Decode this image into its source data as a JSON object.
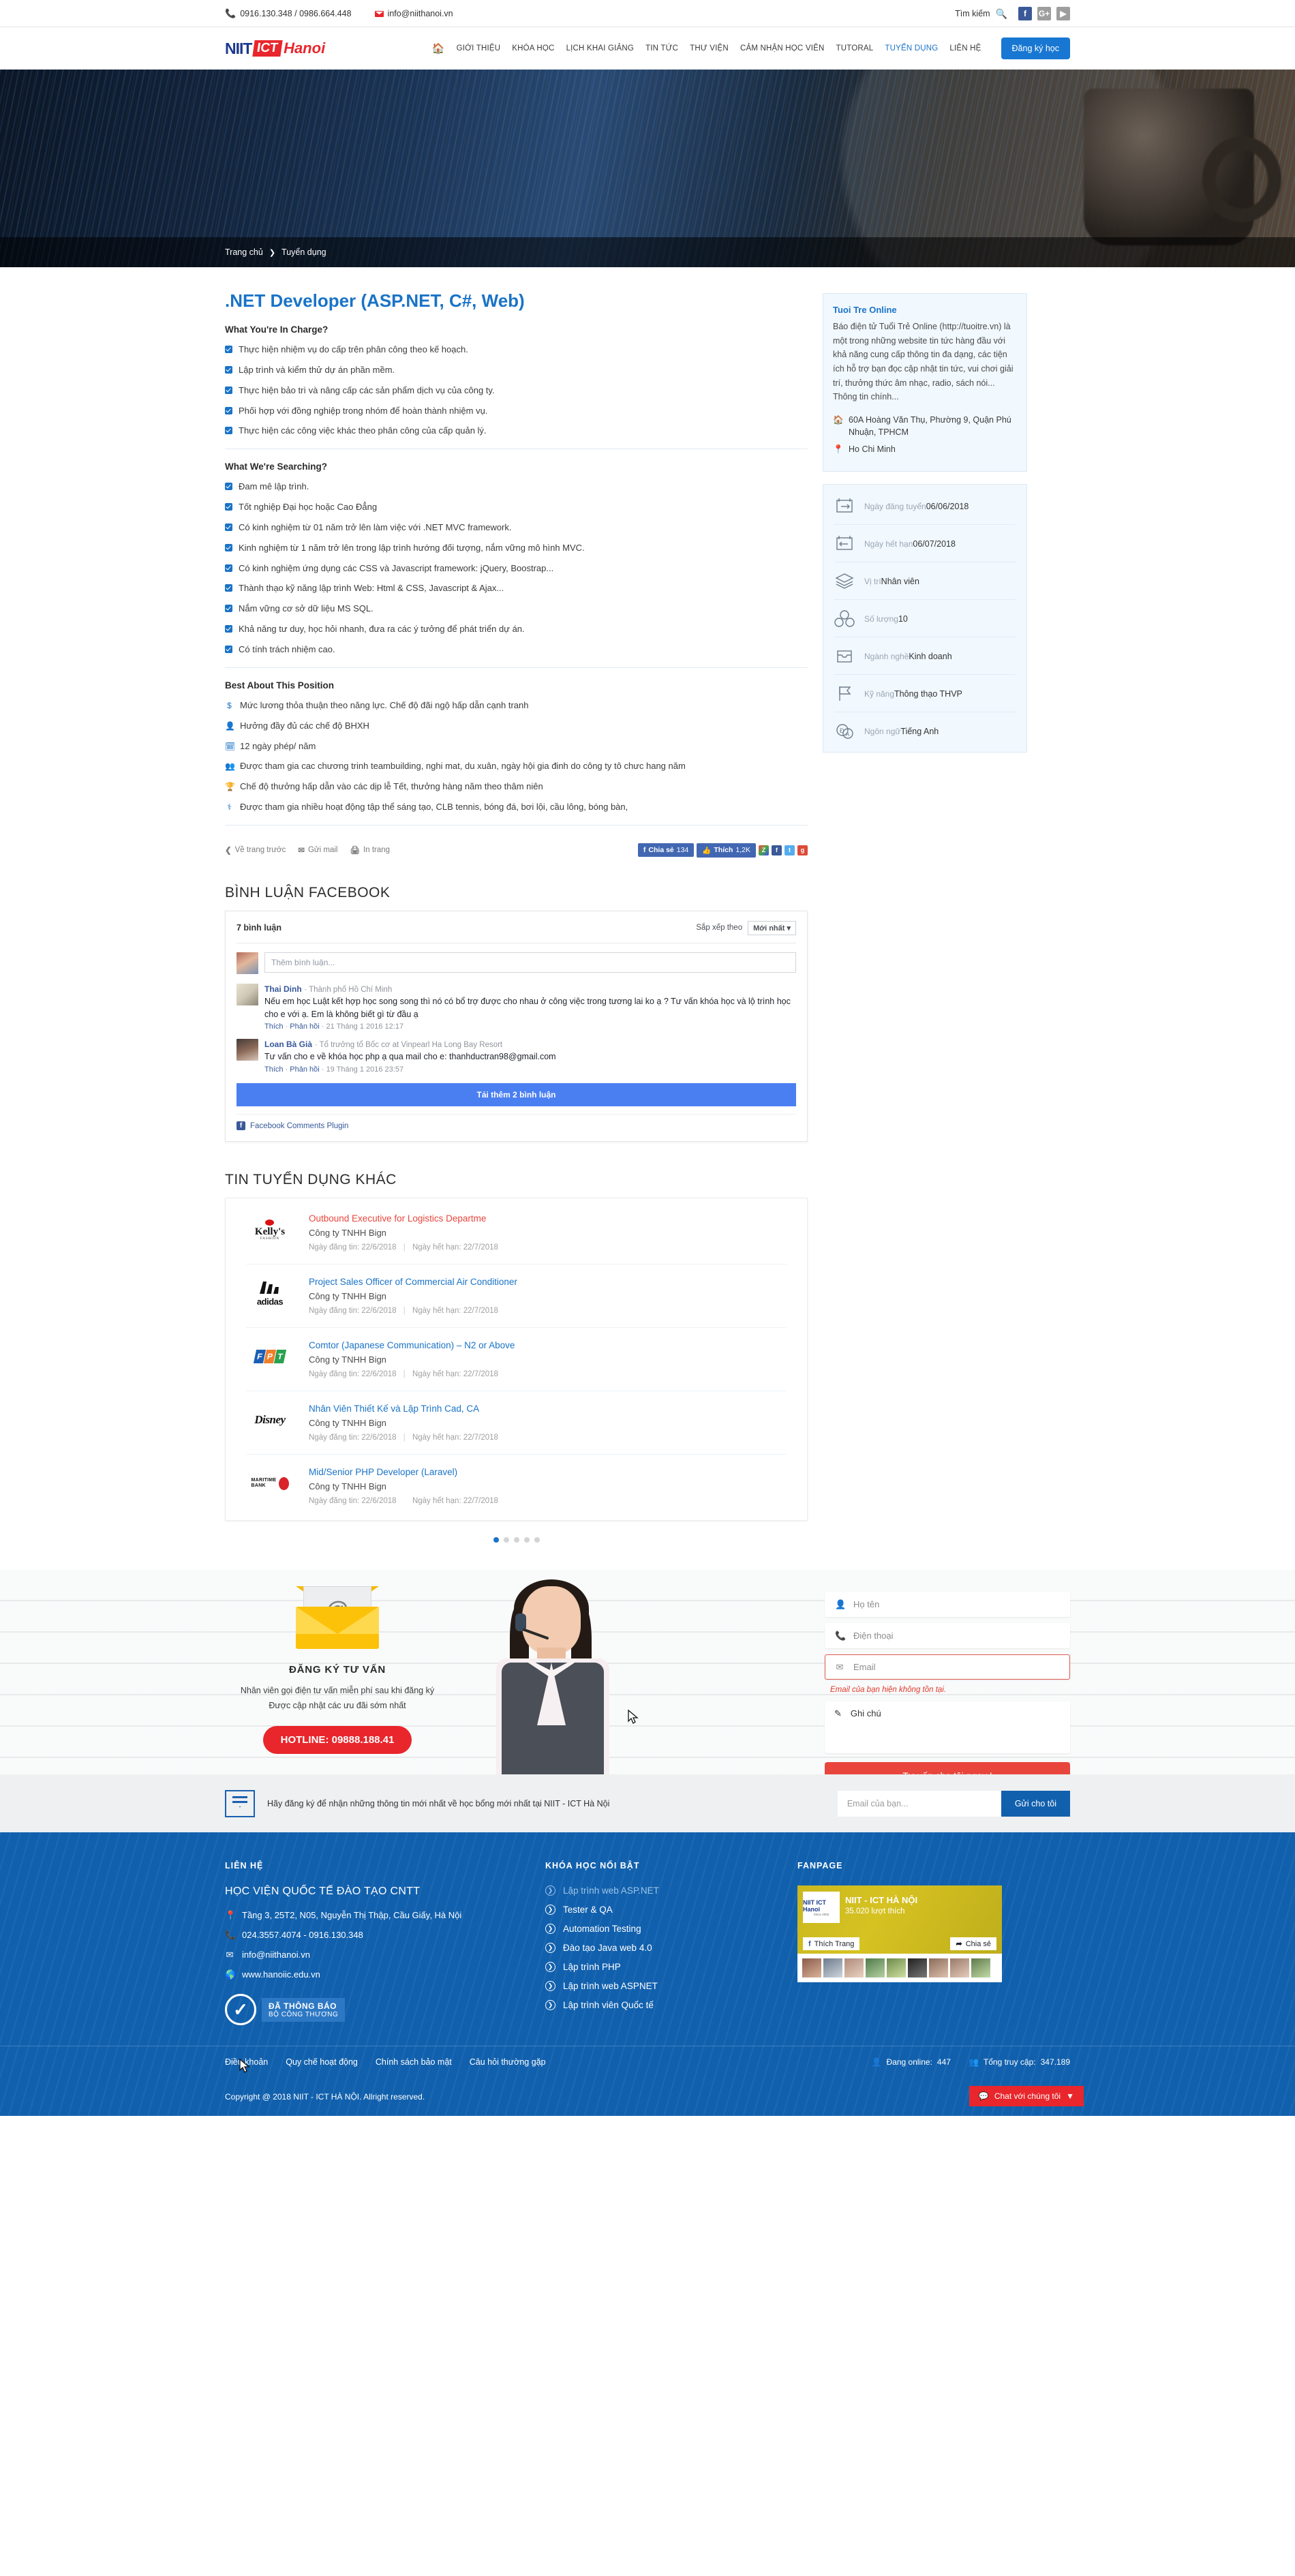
{
  "topbar": {
    "phones": "0916.130.348 / 0986.664.448",
    "email": "info@niithanoi.vn",
    "search_label": "Tìm kiếm",
    "socials": [
      "f",
      "G+",
      "▶"
    ]
  },
  "header": {
    "logo": {
      "niit": "NIIT",
      "ict": "ICT",
      "hanoi": "Hanoi"
    },
    "menu": [
      {
        "label": "GIỚI THIỆU",
        "active": false
      },
      {
        "label": "KHÓA HỌC",
        "active": false
      },
      {
        "label": "LỊCH KHAI GIẢNG",
        "active": false
      },
      {
        "label": "TIN TỨC",
        "active": false
      },
      {
        "label": "THƯ VIỆN",
        "active": false
      },
      {
        "label": "CẢM NHẬN HỌC VIÊN",
        "active": false
      },
      {
        "label": "TUTORAL",
        "active": false
      },
      {
        "label": "TUYỂN DỤNG",
        "active": true
      },
      {
        "label": "LIÊN HỆ",
        "active": false
      }
    ],
    "register_button": "Đăng ký học"
  },
  "breadcrumb": {
    "home": "Trang chủ",
    "sep": "❯",
    "current": "Tuyển dụng"
  },
  "job": {
    "title": ".NET Developer (ASP.NET, C#, Web)",
    "section1_title": "What You're In Charge?",
    "section1_items": [
      "Thực hiện nhiệm vụ do cấp trên phân công theo kế hoạch.",
      "Lập trình và kiểm thử dự án phần mềm.",
      "Thực hiện bảo trì và nâng cấp các sản phẩm dịch vụ của công ty.",
      "Phối hợp với đồng nghiệp trong nhóm để hoàn thành nhiệm vụ.",
      "Thực hiện các công việc khác theo phân công của cấp quản lý."
    ],
    "section2_title": "What We're Searching?",
    "section2_items": [
      "Đam mê lập trình.",
      "Tốt nghiệp Đại học hoặc Cao Đẳng",
      "Có kinh nghiệm từ 01 năm trở lên làm việc với .NET MVC framework.",
      "Kinh nghiệm từ 1 năm trở lên trong lập trình hướng đối tượng, nắm vững mô hình MVC.",
      "Có kinh nghiệm ứng dụng các CSS và Javascript framework: jQuery, Boostrap...",
      "Thành thạo kỹ năng lập trình Web: Html & CSS, Javascript & Ajax...",
      "Nắm vững cơ sở dữ liệu MS SQL.",
      "Khả năng tư duy, học hỏi nhanh, đưa ra các ý tưởng để phát triển dự án.",
      "Có tính trách nhiệm cao."
    ],
    "section3_title": "Best About This Position",
    "section3_items": [
      {
        "icon": "$",
        "text": "Mức lương thỏa thuận theo năng lực. Chế độ đãi ngộ hấp dẫn cạnh tranh"
      },
      {
        "icon": "👤",
        "text": "Hưởng đầy đủ các chế độ BHXH"
      },
      {
        "icon": "🗓",
        "text": "12 ngày phép/ năm"
      },
      {
        "icon": "👥",
        "text": "Được tham gia cac chương trinh teambuilding, nghi mat, du xuân, ngày hội gia đinh do công ty tô chưc hang năm"
      },
      {
        "icon": "🏆",
        "text": "Chế độ thưởng hấp dẫn vào các dịp lễ Tết, thưởng hàng năm theo thâm niên"
      },
      {
        "icon": "⚕",
        "text": "Được tham gia nhiều hoạt động tập thể sáng tạo, CLB tennis, bóng đá, bơi lội, cầu lông, bóng bàn,"
      }
    ],
    "actions": [
      {
        "icon": "❮",
        "label": "Về trang trước"
      },
      {
        "icon": "✉",
        "label": "Gửi mail"
      },
      {
        "icon": "🖨",
        "label": "In trang"
      }
    ],
    "share": {
      "fb_share_label": "Chia sẻ",
      "fb_share_count": "134",
      "fb_like_label": "Thích",
      "fb_like_count": "1,2K"
    }
  },
  "company": {
    "name": "Tuoi Tre Online",
    "description": "Báo điện tử Tuổi Trẻ Online (http://tuoitre.vn) là một trong những website tin tức hàng đầu với khả năng cung cấp thông tin đa dạng, các tiện ích hỗ trợ bạn đọc cập nhật tin tức, vui chơi giải trí, thưởng thức âm nhạc, radio, sách nói... Thông tin chính...",
    "address": "60A Hoàng Văn Thụ, Phường 9, Quận Phú Nhuận, TPHCM",
    "city": "Ho Chi Minh"
  },
  "job_meta": [
    {
      "icon": "calendar-post-icon",
      "label": "Ngày đăng tuyển",
      "value": "06/06/2018"
    },
    {
      "icon": "calendar-expire-icon",
      "label": "Ngày hết hạn",
      "value": "06/07/2018"
    },
    {
      "icon": "layers-icon",
      "label": "Vị trí",
      "value": "Nhân viên"
    },
    {
      "icon": "numbers-icon",
      "label": "Số lượng",
      "value": "10"
    },
    {
      "icon": "tray-icon",
      "label": "Ngành nghề",
      "value": "Kinh doanh"
    },
    {
      "icon": "flag-icon",
      "label": "Kỹ năng",
      "value": "Thông thạo THVP"
    },
    {
      "icon": "translate-icon",
      "label": "Ngôn ngữ",
      "value": "Tiếng Anh"
    }
  ],
  "comments": {
    "heading": "BÌNH LUẬN FACEBOOK",
    "count_label": "7 bình luận",
    "sort_label": "Sắp xếp theo",
    "sort_value": "Mới nhất",
    "add_placeholder": "Thêm bình luận...",
    "items": [
      {
        "name": "Thai Dinh",
        "meta": "· Thành phố Hồ Chí Minh",
        "text": "Nếu em học Luật kết hợp học song song thì nó có bổ trợ được cho nhau ở công việc trong tương lai ko ạ ? Tư vấn khóa học và lộ trình học cho e với ạ. Em là không biết gì từ đầu ạ",
        "like": "Thích",
        "reply": "Phản hồi",
        "time": "21 Tháng 1 2016 12:17"
      },
      {
        "name": "Loan Bà Già",
        "meta": "· Tổ trưởng tổ Bốc cơ at Vinpearl Ha Long Bay Resort",
        "text": "Tư vấn cho e về khóa học php ạ qua mail cho e: thanhductran98@gmail.com",
        "like": "Thích",
        "reply": "Phản hồi",
        "time": "19 Tháng 1 2016 23:57"
      }
    ],
    "load_more": "Tải thêm 2 bình luận",
    "plugin_label": "Facebook Comments Plugin"
  },
  "other_jobs": {
    "heading": "TIN TUYỂN DỤNG KHÁC",
    "posted_label": "Ngày đăng tin:",
    "expire_label": "Ngày hết hạn:",
    "items": [
      {
        "logo": "kellys",
        "title": "Outbound Executive for Logistics Departme",
        "highlight": true,
        "company": "Công ty TNHH Bign",
        "posted": "22/6/2018",
        "expire": "22/7/2018"
      },
      {
        "logo": "adidas",
        "title": "Project Sales Officer of Commercial Air Conditioner",
        "highlight": false,
        "company": "Công ty TNHH Bign",
        "posted": "22/6/2018",
        "expire": "22/7/2018"
      },
      {
        "logo": "fpt",
        "title": "Comtor (Japanese Communication) – N2 or Above",
        "highlight": false,
        "company": "Công ty TNHH Bign",
        "posted": "22/6/2018",
        "expire": "22/7/2018"
      },
      {
        "logo": "disney",
        "title": "Nhân Viên Thiết Kế và Lập Trình Cad, CA",
        "highlight": false,
        "company": "Công ty TNHH Bign",
        "posted": "22/6/2018",
        "expire": "22/7/2018"
      },
      {
        "logo": "maritime",
        "title": "Mid/Senior PHP Developer (Laravel)",
        "highlight": false,
        "company": "Công ty TNHH Bign",
        "posted": "22/6/2018",
        "expire": "22/7/2018"
      }
    ],
    "dots": 5,
    "active_dot": 0
  },
  "cta": {
    "title": "ĐĂNG KÝ TƯ VẤN",
    "line1": "Nhân viên gọi điện tư vấn miễn phí sau khi đăng ký",
    "line2": "Được cập nhật các ưu đãi sớm nhất",
    "hotline": "HOTLINE: 09888.188.41",
    "form": {
      "name_placeholder": "Họ tên",
      "phone_placeholder": "Điện thoại",
      "email_placeholder": "Email",
      "email_error": "Email của bạn hiện không tồn tại.",
      "note_placeholder": "Ghi chú",
      "submit": "Tư vấn cho tôi ngay !"
    }
  },
  "newsletter": {
    "text": "Hãy đăng ký để nhận những thông tin mới nhất về học bổng mới nhất tại NIIT - ICT Hà Nội",
    "placeholder": "Email của bạn...",
    "button": "Gửi cho tôi"
  },
  "footer": {
    "contact_head": "LIÊN HỆ",
    "org": "HỌC VIỆN QUỐC TẾ ĐÀO TẠO CNTT",
    "address": "Tầng 3, 25T2, N05, Nguyễn Thị Thập, Cầu Giấy, Hà Nội",
    "phone": "024.3557.4074 - 0916.130.348",
    "email": "info@niithanoi.vn",
    "website": "www.hanoiic.edu.vn",
    "badge_line1": "ĐÃ THÔNG BÁO",
    "badge_line2": "BỘ CÔNG THƯƠNG",
    "courses_head": "KHÓA HỌC NỔI BẬT",
    "courses": [
      {
        "label": "Lập trình web ASP.NET",
        "hovered": true
      },
      {
        "label": "Tester & QA",
        "hovered": false
      },
      {
        "label": "Automation Testing",
        "hovered": false
      },
      {
        "label": "Đào tạo Java web 4.0",
        "hovered": false
      },
      {
        "label": "Lập trình PHP",
        "hovered": false
      },
      {
        "label": "Lập trình web ASPNET",
        "hovered": false
      },
      {
        "label": "Lập trình viên Quốc tế",
        "hovered": false
      }
    ],
    "fanpage_head": "FANPAGE",
    "fanpage": {
      "name": "NIIT - ICT HÀ NỘI",
      "likes": "35.020 lượt thích",
      "like_button": "Thích Trang",
      "share_button": "Chia sẻ",
      "logo_text": "NIIT ICT Hanoi",
      "logo_sub": "Since 2002"
    },
    "links": [
      "Điều khoản",
      "Quy chế hoạt động",
      "Chính sách bảo mật",
      "Câu hỏi thường gặp"
    ],
    "online_label": "Đang online:",
    "online_value": "447",
    "total_label": "Tổng truy cập:",
    "total_value": "347.189",
    "copyright": "Copyright @ 2018 NIIT - ICT HÀ NỘI. Allright reserved.",
    "chat_button": "Chat với chúng tôi",
    "chat_caret": "▼",
    "to_top": "⬆"
  }
}
